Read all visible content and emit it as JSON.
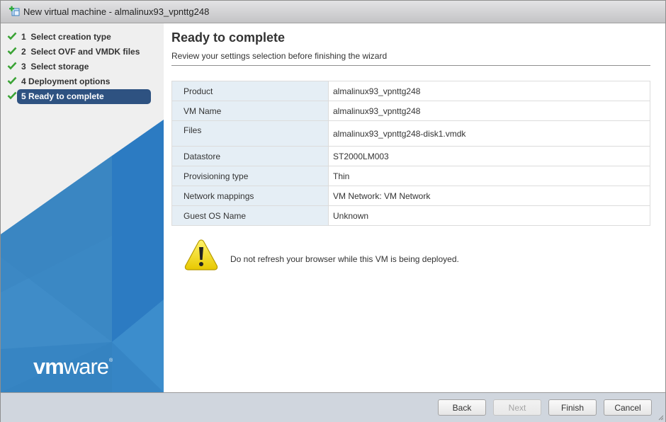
{
  "window": {
    "title": "New virtual machine - almalinux93_vpnttg248",
    "icon": "new-vm-icon"
  },
  "sidebar": {
    "steps": [
      {
        "number": "1",
        "label": "Select creation type",
        "completed": true,
        "active": false
      },
      {
        "number": "2",
        "label": "Select OVF and VMDK files",
        "completed": true,
        "active": false
      },
      {
        "number": "3",
        "label": "Select storage",
        "completed": true,
        "active": false
      },
      {
        "number": "4",
        "label": "Deployment options",
        "completed": true,
        "active": false
      },
      {
        "number": "5",
        "label": "Ready to complete",
        "completed": true,
        "active": true
      }
    ],
    "logo": {
      "bold": "vm",
      "light": "ware",
      "mark": "®"
    }
  },
  "main": {
    "title": "Ready to complete",
    "subtitle": "Review your settings selection before finishing the wizard",
    "summary": [
      {
        "key": "Product",
        "value": "almalinux93_vpnttg248"
      },
      {
        "key": "VM Name",
        "value": "almalinux93_vpnttg248"
      },
      {
        "key": "Files",
        "value": "almalinux93_vpnttg248-disk1.vmdk"
      },
      {
        "key": "Datastore",
        "value": "ST2000LM003"
      },
      {
        "key": "Provisioning type",
        "value": "Thin"
      },
      {
        "key": "Network mappings",
        "value": "VM Network: VM Network"
      },
      {
        "key": "Guest OS Name",
        "value": "Unknown"
      }
    ],
    "warning": {
      "icon": "warning-icon",
      "text": "Do not refresh your browser while this VM is being deployed."
    }
  },
  "footer": {
    "back_label": "Back",
    "next_label": "Next",
    "finish_label": "Finish",
    "cancel_label": "Cancel",
    "next_disabled": true
  },
  "colors": {
    "active_step_bg": "#2e5281",
    "check_green": "#3aa335",
    "table_key_bg": "#e5eef5",
    "brand_blue": "#2e7bc4",
    "footer_bg": "#d0d6de"
  }
}
